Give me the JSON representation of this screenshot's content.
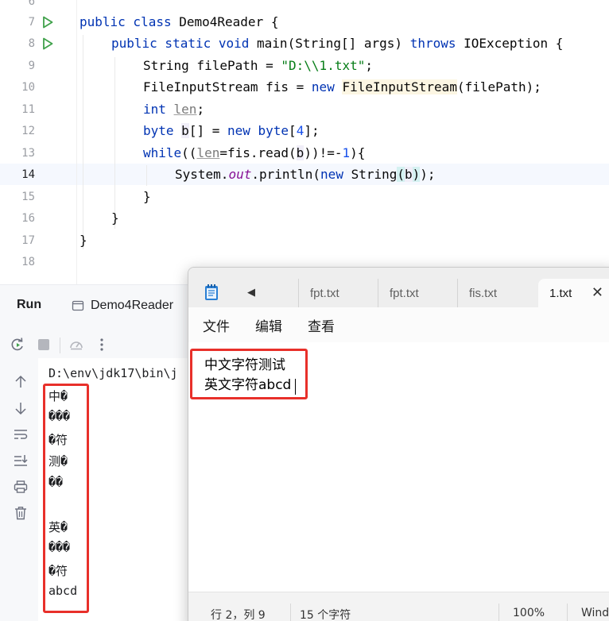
{
  "editor": {
    "line_numbers": [
      "6",
      "7",
      "8",
      "9",
      "10",
      "11",
      "12",
      "13",
      "14",
      "15",
      "16",
      "17",
      "18"
    ],
    "code": {
      "l7_kw": "public class ",
      "l7_name": "Demo4Reader {",
      "l8_kw1": "public static void ",
      "l8_mid": "main(String[] args) ",
      "l8_kw2": "throws ",
      "l8_end": "IOException {",
      "l9_a": "String filePath = ",
      "l9_str": "\"D:\\\\1.txt\"",
      "l9_end": ";",
      "l10_a": "FileInputStream fis = ",
      "l10_new": "new ",
      "l10_ctor": "FileInputStream",
      "l10_end": "(filePath);",
      "l11_kw": "int ",
      "l11_var": "len",
      "l11_end": ";",
      "l12_kw": "byte ",
      "l12_b": "b",
      "l12_mid": "[] = ",
      "l12_new": "new ",
      "l12_kw2": "byte",
      "l12_open": "[",
      "l12_num": "4",
      "l12_end": "];",
      "l13_kw": "while",
      "l13_a": "((",
      "l13_len": "len",
      "l13_b_pre": "=fis.read(",
      "l13_b": "b",
      "l13_mid": "))!=-",
      "l13_num": "1",
      "l13_end": "){",
      "l14_a": "System.",
      "l14_fld": "out",
      "l14_b": ".println(",
      "l14_new": "new ",
      "l14_c": "String",
      "l14_p1": "(",
      "l14_arg": "b",
      "l14_p2": ")",
      "l14_end": ");",
      "l15": "}",
      "l16": "}",
      "l17": "}"
    }
  },
  "run_panel": {
    "title": "Run",
    "tab_label": "Demo4Reader",
    "command": "D:\\env\\jdk17\\bin\\j",
    "output": [
      "中�",
      "���",
      "�符",
      "测�",
      "��",
      "",
      "英�",
      "���",
      "�符",
      "abcd"
    ]
  },
  "notepad": {
    "tabs": [
      "fpt.txt",
      "fpt.txt",
      "fis.txt",
      "1.txt"
    ],
    "menu": [
      "文件",
      "编辑",
      "查看"
    ],
    "content": [
      "中文字符测试",
      "英文字符abcd"
    ],
    "status": {
      "position": "行 2，列 9",
      "char_count": "15 个字符",
      "zoom": "100%",
      "line_ending": "Wind"
    }
  },
  "colors": {
    "highlight_box": "#e8302a",
    "keyword": "#0033b3",
    "string": "#067d17",
    "run_arrow": "#3fa14a"
  }
}
